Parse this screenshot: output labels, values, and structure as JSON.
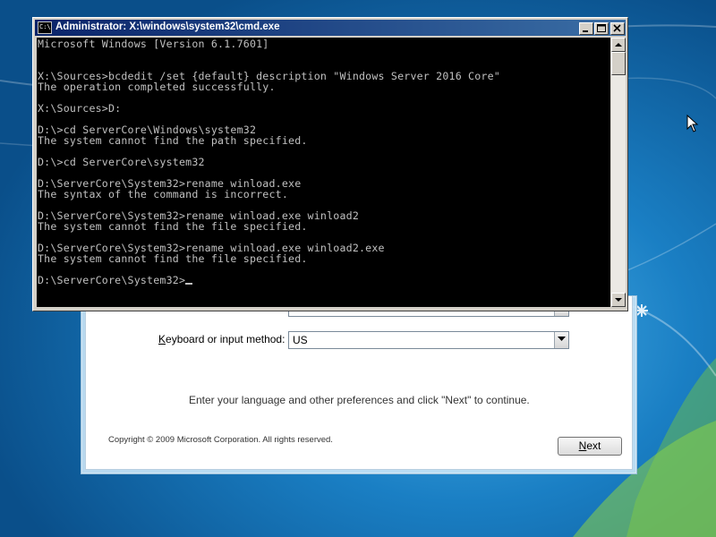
{
  "cmd_window": {
    "title": "Administrator: X:\\windows\\system32\\cmd.exe",
    "console_lines": [
      "Microsoft Windows [Version 6.1.7601]",
      "",
      "",
      "X:\\Sources>bcdedit /set {default} description \"Windows Server 2016 Core\"",
      "The operation completed successfully.",
      "",
      "X:\\Sources>D:",
      "",
      "D:\\>cd ServerCore\\Windows\\system32",
      "The system cannot find the path specified.",
      "",
      "D:\\>cd ServerCore\\system32",
      "",
      "D:\\ServerCore\\System32>rename winload.exe",
      "The syntax of the command is incorrect.",
      "",
      "D:\\ServerCore\\System32>rename winload.exe winload2",
      "The system cannot find the file specified.",
      "",
      "D:\\ServerCore\\System32>rename winload.exe winload2.exe",
      "The system cannot find the file specified.",
      "",
      "D:\\ServerCore\\System32>"
    ],
    "prompt": "D:\\ServerCore\\System32>",
    "icon": "cmd-icon",
    "controls": [
      "minimize-icon",
      "maximize-icon",
      "close-icon"
    ]
  },
  "setup": {
    "keyboard_label_prefix": "",
    "keyboard_label_accel": "K",
    "keyboard_label_rest": "eyboard or input method:",
    "keyboard_value": "US",
    "instructions": "Enter your language and other preferences and click \"Next\" to continue.",
    "copyright": "Copyright © 2009 Microsoft Corporation. All rights reserved.",
    "next_accel": "N",
    "next_rest": "ext"
  },
  "colors": {
    "desktop_top": "#0b5f9e",
    "titlebar": "#0a246a",
    "console_bg": "#000000",
    "console_text": "#c0c0c0"
  }
}
